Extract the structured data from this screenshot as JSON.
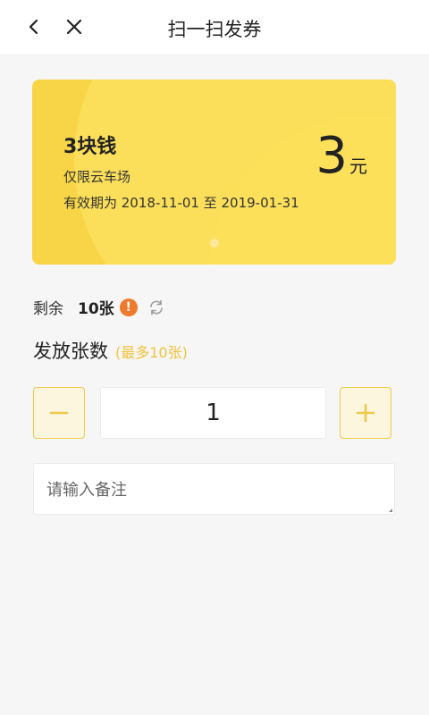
{
  "header": {
    "title": "扫一扫发券",
    "back_icon": "chevron-left-icon",
    "close_icon": "close-icon"
  },
  "coupon": {
    "name": "3块钱",
    "scope": "仅限云车场",
    "validity": "有效期为 2018-11-01 至 2019-01-31",
    "amount": "3",
    "unit": "元",
    "page_count": 2,
    "active_page": 1,
    "color": "#f7d547"
  },
  "remain": {
    "label": "剩余",
    "count": "10张",
    "warn_glyph": "!",
    "warn_color": "#ef7a2e"
  },
  "quantity": {
    "label": "发放张数",
    "hint": "(最多10张)",
    "value": "1",
    "accent": "#f0c94a"
  },
  "remark": {
    "placeholder": "请输入备注"
  }
}
